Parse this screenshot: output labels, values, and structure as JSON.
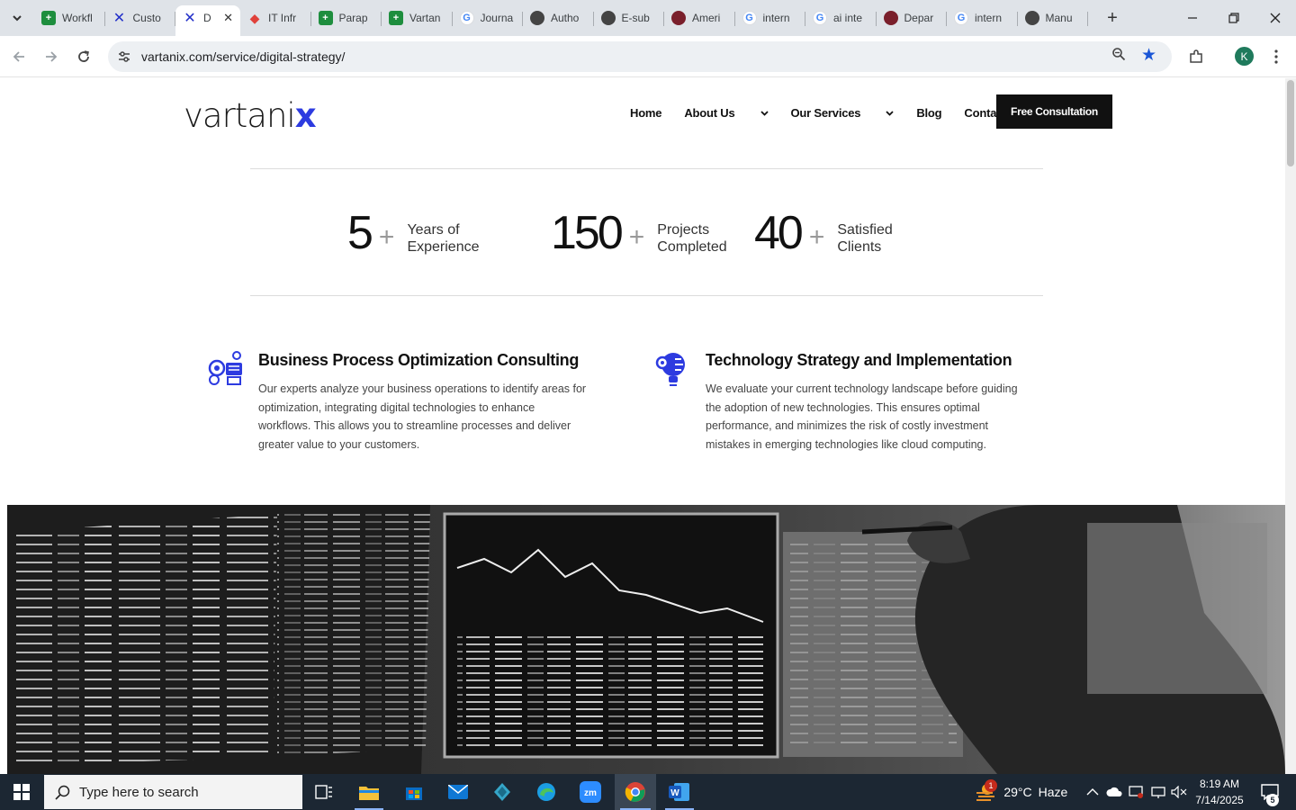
{
  "browser": {
    "tabs": [
      {
        "title": "Workfl",
        "icon": "sheets-icon"
      },
      {
        "title": "Custo",
        "icon": "vartanix-icon"
      },
      {
        "title": "D",
        "icon": "vartanix-icon",
        "active": true
      },
      {
        "title": "IT Infr",
        "icon": "pdf-icon"
      },
      {
        "title": "Parap",
        "icon": "sheets-icon"
      },
      {
        "title": "Vartan",
        "icon": "sheets-icon"
      },
      {
        "title": "Journa",
        "icon": "google-icon"
      },
      {
        "title": "Autho",
        "icon": "globe-icon"
      },
      {
        "title": "E-sub",
        "icon": "globe-icon"
      },
      {
        "title": "Ameri",
        "icon": "site-icon"
      },
      {
        "title": "intern",
        "icon": "google-icon"
      },
      {
        "title": "ai inte",
        "icon": "google-icon"
      },
      {
        "title": "Depar",
        "icon": "site-icon"
      },
      {
        "title": "intern",
        "icon": "google-icon"
      },
      {
        "title": "Manu",
        "icon": "github-icon"
      }
    ],
    "close_tab_glyph": "✕",
    "url": "vartanix.com/service/digital-strategy/",
    "profile_initial": "K"
  },
  "site": {
    "logo_text": "vartani",
    "logo_x": "x",
    "nav": {
      "home": "Home",
      "about": "About Us",
      "services": "Our Services",
      "blog": "Blog",
      "contact": "Contact Us"
    },
    "cta": "Free Consultation",
    "stats": [
      {
        "number": "5",
        "plus": "+",
        "label_line1": "Years of",
        "label_line2": "Experience"
      },
      {
        "number": "150",
        "plus": "+",
        "label_line1": "Projects",
        "label_line2": "Completed"
      },
      {
        "number": "40",
        "plus": "+",
        "label_line1": "Satisfied",
        "label_line2": "Clients"
      }
    ],
    "services": [
      {
        "title": "Business Process Optimization Consulting",
        "body": "Our experts analyze your business operations to identify areas for optimization, integrating digital technologies to enhance workflows. This allows you to streamline processes and deliver greater value to your customers.",
        "icon": "process-gears-icon"
      },
      {
        "title": "Technology Strategy and Implementation",
        "body": "We evaluate your current technology landscape before guiding the adoption of new technologies. This ensures optimal performance, and minimizes the risk of costly investment mistakes in emerging technologies like cloud computing.",
        "icon": "tech-bulb-icon"
      }
    ],
    "accent_color": "#2d3be0"
  },
  "taskbar": {
    "search_placeholder": "Type here to search",
    "weather_temp": "29°C",
    "weather_desc": "Haze",
    "weather_badge": "1",
    "time": "8:19 AM",
    "date": "7/14/2025",
    "notif_count": "5"
  }
}
